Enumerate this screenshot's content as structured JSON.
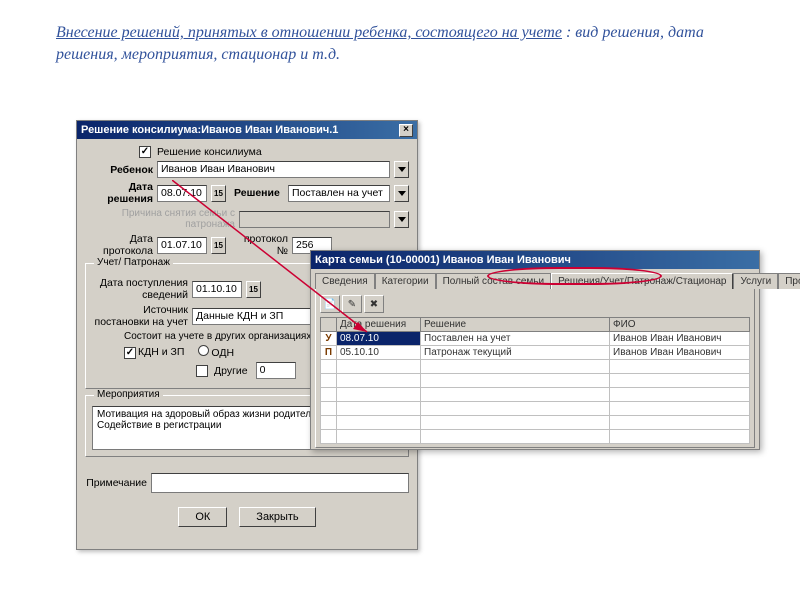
{
  "heading": {
    "underlined": "Внесение решений, принятых в отношении ребенка, состоящего на учете",
    "rest": " : вид решения, дата решения, мероприятия, стационар и т.д."
  },
  "dlg1": {
    "title": "Решение консилиума:Иванов Иван Иванович.1",
    "consilium_chk_label": "Решение консилиума",
    "child_label": "Ребенок",
    "child_value": "Иванов Иван Иванович",
    "decision_date_label": "Дата решения",
    "decision_date_value": "08.07.10",
    "decision_label": "Решение",
    "decision_value": "Поставлен на учет",
    "reason_label": "Причина снятия семьи с патронажа",
    "protocol_date_label": "Дата протокола",
    "protocol_date_value": "01.07.10",
    "protocol_no_label": "протокол №",
    "protocol_no_value": "256",
    "group_reg": "Учет/ Патронаж",
    "info_date_label": "Дата поступления сведений",
    "info_date_value": "01.10.10",
    "source_label": "Источник постановки на учет",
    "source_value": "Данные КДН и ЗП",
    "other_org_label": "Состоит на учете в других организациях",
    "kdn_label": "КДН и ЗП",
    "odn_label": "ОДН",
    "other_label": "Другие",
    "other_value": "0",
    "group_activities": "Мероприятия",
    "activities_text": "Мотивация на здоровый образ жизни родителей\nСодействие в регистрации",
    "note_label": "Примечание",
    "note_value": "",
    "ok": "ОК",
    "close": "Закрыть"
  },
  "dlg2": {
    "title": "Карта семьи (10-00001) Иванов Иван Иванович",
    "tabs": [
      "Сведения",
      "Категории",
      "Полный состав семьи",
      "Решения/Учет/Патронаж/Стационар",
      "Услуги",
      "Проделан"
    ],
    "selected_tab": 3,
    "cols": [
      "",
      "Дата решения",
      "Решение",
      "ФИО"
    ],
    "rows": [
      {
        "mark": "У",
        "date": "08.07.10",
        "decision": "Поставлен на учет",
        "fio": "Иванов Иван Иванович",
        "sel": true
      },
      {
        "mark": "П",
        "date": "05.10.10",
        "decision": "Патронаж текущий",
        "fio": "Иванов Иван Иванович",
        "sel": false
      }
    ]
  }
}
